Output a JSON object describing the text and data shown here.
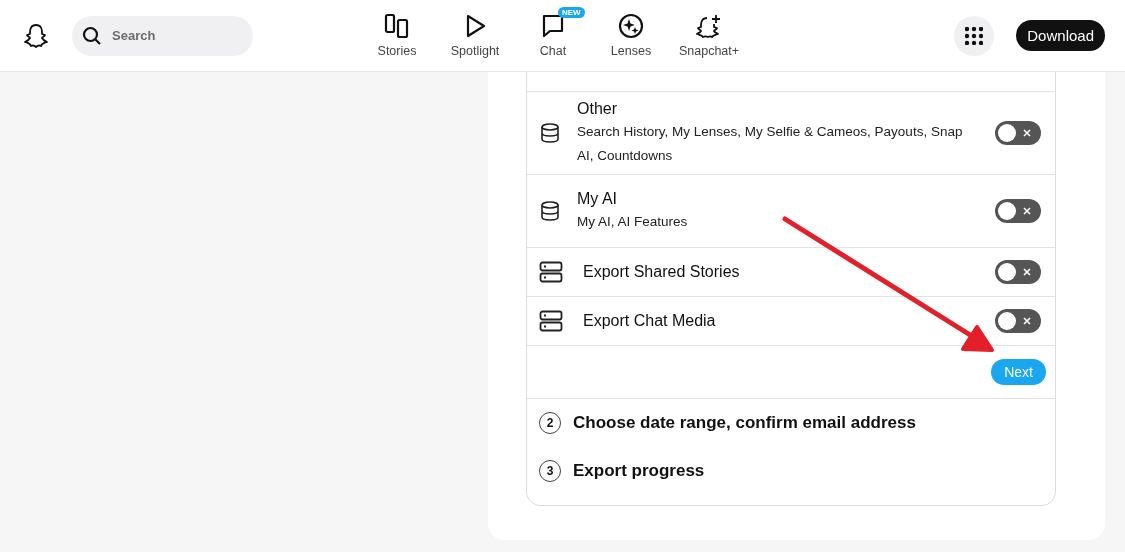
{
  "header": {
    "search": {
      "placeholder": "Search"
    },
    "nav": [
      {
        "label": "Stories",
        "kind": "stories"
      },
      {
        "label": "Spotlight",
        "kind": "spotlight"
      },
      {
        "label": "Chat",
        "kind": "chat",
        "badge": "NEW"
      },
      {
        "label": "Lenses",
        "kind": "lenses"
      },
      {
        "label": "Snapchat+",
        "kind": "plus"
      }
    ],
    "download": "Download"
  },
  "export_options": [
    {
      "kind": "database",
      "title": "Other",
      "subtitle": "Search History, My Lenses, My Selfie & Cameos, Payouts, Snap AI, Countdowns",
      "on": false
    },
    {
      "kind": "database",
      "title": "My AI",
      "subtitle": "My AI, AI Features",
      "on": false
    },
    {
      "kind": "server",
      "title": "Export Shared Stories",
      "on": false
    },
    {
      "kind": "server",
      "title": "Export Chat Media",
      "on": false
    }
  ],
  "next_button": "Next",
  "steps": [
    {
      "number": "2",
      "title": "Choose date range, confirm email address"
    },
    {
      "number": "3",
      "title": "Export progress"
    }
  ]
}
